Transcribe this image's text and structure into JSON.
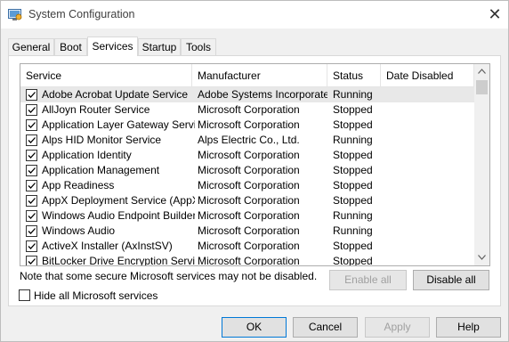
{
  "window": {
    "title": "System Configuration"
  },
  "tabs": [
    "General",
    "Boot",
    "Services",
    "Startup",
    "Tools"
  ],
  "active_tab": "Services",
  "columns": {
    "service": "Service",
    "manufacturer": "Manufacturer",
    "status": "Status",
    "date_disabled": "Date Disabled"
  },
  "services": [
    {
      "name": "Adobe Acrobat Update Service",
      "manufacturer": "Adobe Systems Incorporated",
      "status": "Running",
      "checked": true
    },
    {
      "name": "AllJoyn Router Service",
      "manufacturer": "Microsoft Corporation",
      "status": "Stopped",
      "checked": true
    },
    {
      "name": "Application Layer Gateway Service",
      "manufacturer": "Microsoft Corporation",
      "status": "Stopped",
      "checked": true
    },
    {
      "name": "Alps HID Monitor Service",
      "manufacturer": "Alps Electric Co., Ltd.",
      "status": "Running",
      "checked": true
    },
    {
      "name": "Application Identity",
      "manufacturer": "Microsoft Corporation",
      "status": "Stopped",
      "checked": true
    },
    {
      "name": "Application Management",
      "manufacturer": "Microsoft Corporation",
      "status": "Stopped",
      "checked": true
    },
    {
      "name": "App Readiness",
      "manufacturer": "Microsoft Corporation",
      "status": "Stopped",
      "checked": true
    },
    {
      "name": "AppX Deployment Service (AppX...",
      "manufacturer": "Microsoft Corporation",
      "status": "Stopped",
      "checked": true
    },
    {
      "name": "Windows Audio Endpoint Builder",
      "manufacturer": "Microsoft Corporation",
      "status": "Running",
      "checked": true
    },
    {
      "name": "Windows Audio",
      "manufacturer": "Microsoft Corporation",
      "status": "Running",
      "checked": true
    },
    {
      "name": "ActiveX Installer (AxInstSV)",
      "manufacturer": "Microsoft Corporation",
      "status": "Stopped",
      "checked": true
    },
    {
      "name": "BitLocker Drive Encryption Service",
      "manufacturer": "Microsoft Corporation",
      "status": "Stopped",
      "checked": true
    }
  ],
  "note": "Note that some secure Microsoft services may not be disabled.",
  "buttons": {
    "enable_all": "Enable all",
    "disable_all": "Disable all",
    "ok": "OK",
    "cancel": "Cancel",
    "apply": "Apply",
    "help": "Help"
  },
  "hide_ms_label": "Hide all Microsoft services",
  "hide_ms_checked": false,
  "icons": {
    "app": "system-config-icon",
    "close": "close-icon",
    "check": "checkmark-icon",
    "scroll_up": "chevron-up-icon",
    "scroll_down": "chevron-down-icon"
  }
}
